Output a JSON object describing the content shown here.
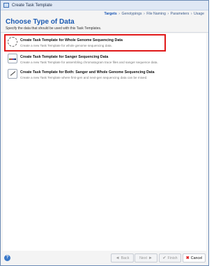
{
  "window": {
    "title": "Create Task Template"
  },
  "breadcrumb": [
    "Targets",
    "Genotypings",
    "File Naming",
    "Parameters",
    "Usage"
  ],
  "breadcrumb_separator": "›",
  "heading": "Choose Type of Data",
  "subtitle": "Specify the data that should be used with this Task Templates.",
  "options": [
    {
      "title": "Create Task Template for Whole Genome Sequencing Data",
      "desc": "Create a new Task Template for whole genome sequencing data."
    },
    {
      "title": "Create Task Template for Sanger Sequencing Data",
      "desc": "Create a new Task Template for assembling chromatogram trace files and sanger sequence data."
    },
    {
      "title": "Create Task Template for Both: Sanger and Whole Genome Sequencing Data",
      "desc": "Create a new Task Template where first-gen and next-gen sequencing data can be mixed."
    }
  ],
  "footer": {
    "help_glyph": "?",
    "back_label": "Back",
    "back_glyph": "◄",
    "next_label": "Next",
    "next_glyph": "►",
    "finish_label": "Finish",
    "finish_glyph": "✔",
    "cancel_label": "Cancel",
    "cancel_glyph": "✖"
  },
  "colors": {
    "accent": "#1c5bb3",
    "highlight": "#e01818"
  }
}
